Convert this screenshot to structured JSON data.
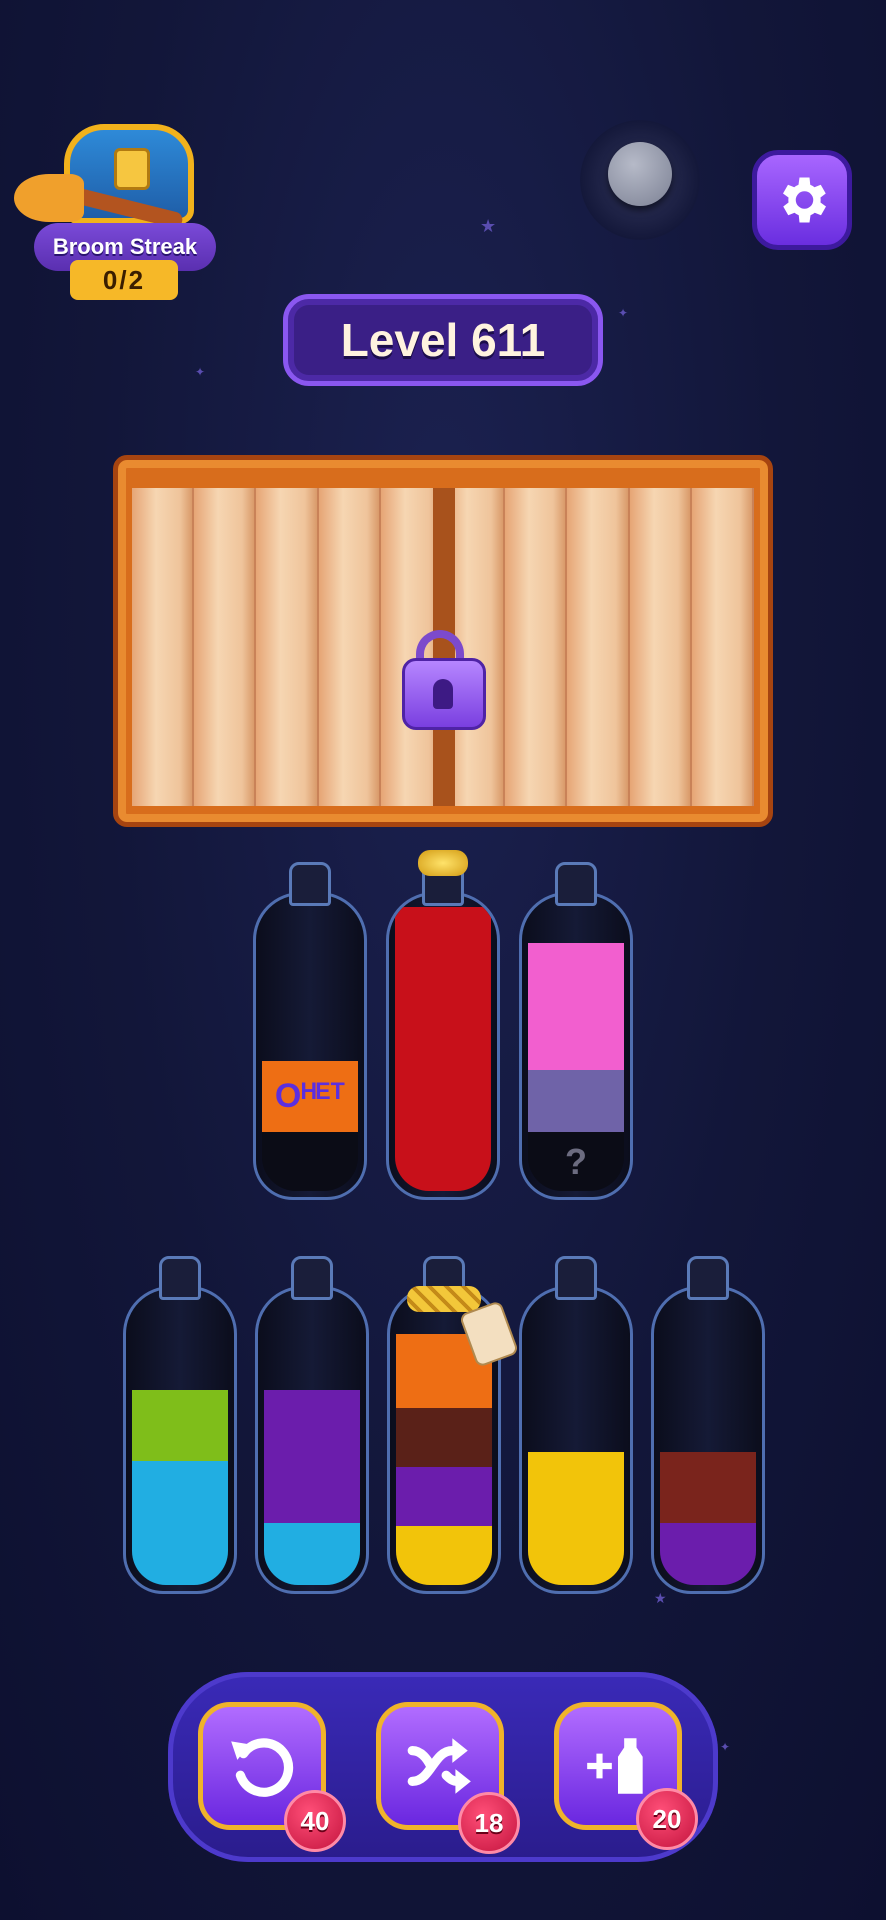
{
  "streak": {
    "title": "Broom Streak",
    "count": "0/2"
  },
  "level": {
    "label": "Level 611"
  },
  "top_bottles": [
    {
      "layers": [
        {
          "color": "#0b0c16",
          "fill": 0.2
        },
        {
          "color": "#ee6e14",
          "fill": 0.24,
          "key_label": "Oᴴᴱᵀ"
        }
      ]
    },
    {
      "corked": true,
      "layers": [
        {
          "color": "#c8101a",
          "fill": 0.96
        }
      ]
    },
    {
      "layers": [
        {
          "color": "#0b0c16",
          "fill": 0.2,
          "mystery": "?"
        },
        {
          "color": "#6f63a8",
          "fill": 0.21
        },
        {
          "color": "#f25fcf",
          "fill": 0.43
        }
      ]
    }
  ],
  "bottom_bottles": [
    {
      "layers": [
        {
          "color": "#21aee2",
          "fill": 0.42
        },
        {
          "color": "#7fbe1a",
          "fill": 0.24
        }
      ]
    },
    {
      "layers": [
        {
          "color": "#21aee2",
          "fill": 0.21
        },
        {
          "color": "#6b1dac",
          "fill": 0.45
        }
      ]
    },
    {
      "roped": true,
      "layers": [
        {
          "color": "#f2c40a",
          "fill": 0.2
        },
        {
          "color": "#6b1dac",
          "fill": 0.2
        },
        {
          "color": "#5a2118",
          "fill": 0.2
        },
        {
          "color": "#ee6e14",
          "fill": 0.25
        }
      ]
    },
    {
      "layers": [
        {
          "color": "#f2c40a",
          "fill": 0.45
        }
      ]
    },
    {
      "layers": [
        {
          "color": "#6b1dac",
          "fill": 0.21
        },
        {
          "color": "#7a241c",
          "fill": 0.24
        }
      ]
    }
  ],
  "tools": {
    "undo_count": "40",
    "shuffle_count": "18",
    "add_bottle_count": "20"
  }
}
